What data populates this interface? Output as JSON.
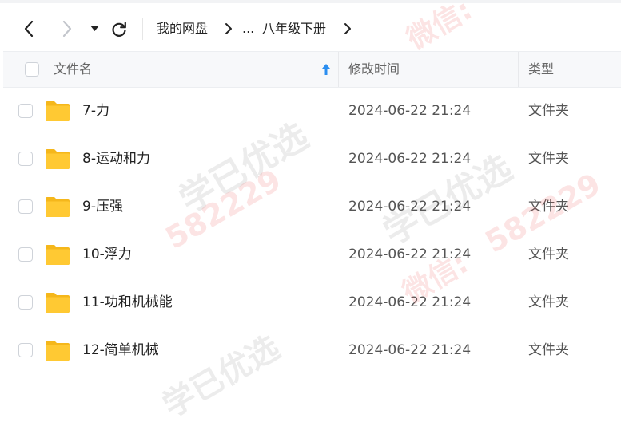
{
  "toolbar": {
    "back_icon": "chevron-left-icon",
    "forward_icon": "chevron-right-icon",
    "dropdown_icon": "caret-down-icon",
    "refresh_icon": "refresh-icon",
    "breadcrumb": {
      "root": "我的网盘",
      "ellipsis": "...",
      "current": "八年级下册"
    }
  },
  "table": {
    "columns": {
      "name": "文件名",
      "modified": "修改时间",
      "type": "类型"
    },
    "sort_icon": "arrow-up-icon",
    "rows": [
      {
        "name": "7-力",
        "modified": "2024-06-22 21:24",
        "type": "文件夹"
      },
      {
        "name": "8-运动和力",
        "modified": "2024-06-22 21:24",
        "type": "文件夹"
      },
      {
        "name": "9-压强",
        "modified": "2024-06-22 21:24",
        "type": "文件夹"
      },
      {
        "name": "10-浮力",
        "modified": "2024-06-22 21:24",
        "type": "文件夹"
      },
      {
        "name": "11-功和机械能",
        "modified": "2024-06-22 21:24",
        "type": "文件夹"
      },
      {
        "name": "12-简单机械",
        "modified": "2024-06-22 21:24",
        "type": "文件夹"
      }
    ]
  },
  "watermark": {
    "wechat": "微信:",
    "number": "582229",
    "brand": "学已优选"
  },
  "colors": {
    "folder": "#ffc933",
    "sort_arrow": "#2b8ef0"
  }
}
